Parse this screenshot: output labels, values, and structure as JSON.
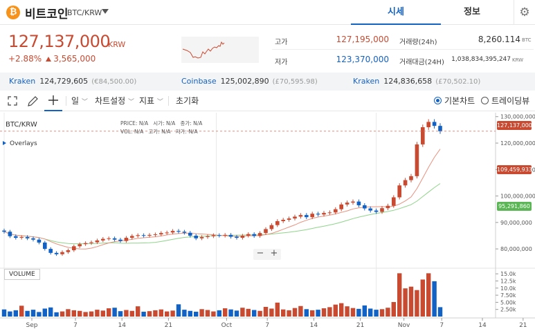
{
  "header": {
    "coin_symbol_glyph": "₿",
    "coin_name": "비트코인",
    "pair": "BTC/KRW",
    "tabs": [
      {
        "label": "시세",
        "active": true
      },
      {
        "label": "정보",
        "active": false
      }
    ],
    "settings_icon": "gear-icon"
  },
  "price": {
    "current": "127,137,000",
    "unit": "KRW",
    "change_pct": "+2.88%",
    "change_amt": "3,565,000"
  },
  "stats": {
    "high_label": "고가",
    "high_value": "127,195,000",
    "low_label": "저가",
    "low_value": "123,370,000",
    "volume_label": "거래량(24h)",
    "volume_value": "8,260.114",
    "volume_unit": "BTC",
    "amount_label": "거래대금(24H)",
    "amount_value": "1,038,834,395,247",
    "amount_unit": "KRW"
  },
  "exchanges": [
    {
      "name": "Kraken",
      "price": "124,729,605",
      "sub": "(€84,500.00)"
    },
    {
      "name": "Coinbase",
      "price": "125,002,890",
      "sub": "(£70,595.98)"
    },
    {
      "name": "Kraken",
      "price": "124,836,658",
      "sub": "(£70,502.10)"
    }
  ],
  "toolbar": {
    "expand_icon": "expand-icon",
    "pen_icon": "pen-icon",
    "crosshair_icon": "crosshair-icon",
    "interval": "일",
    "chart_settings": "차트설정",
    "indicators": "지표",
    "reset": "초기화",
    "view_basic": "기본차트",
    "view_tradingview": "트레이딩뷰"
  },
  "chart": {
    "symbol": "BTC/KRW",
    "ohlc_labels": [
      "PRICE:",
      "N/A",
      "시가:",
      "N/A",
      "종가:",
      "N/A",
      "VOL:",
      "N/A",
      "고가:",
      "N/A",
      "저가:",
      "N/A"
    ],
    "overlays_label": "Overlays",
    "volume_label": "VOLUME",
    "zoom_minus": "−",
    "zoom_plus": "+",
    "last_price_label": "127,137,000",
    "ma1_label": "109,459,933",
    "ma2_label": "95,291,860"
  },
  "chart_data": {
    "type": "candlestick",
    "price_axis_ticks": [
      "130,000,000",
      "120,000,000",
      "110,000,000",
      "100,000,000",
      "90,000,000",
      "80,000,000"
    ],
    "price_axis_values": [
      130000000,
      120000000,
      110000000,
      100000000,
      90000000,
      80000000
    ],
    "volume_axis_ticks": [
      "15.0k",
      "12.5k",
      "10.0k",
      "7.50k",
      "5.00k",
      "2.50k"
    ],
    "volume_axis_values": [
      15000,
      12500,
      10000,
      7500,
      5000,
      2500
    ],
    "x_ticks": [
      "Sep",
      "7",
      "14",
      "21",
      "Oct",
      "7",
      "14",
      "21",
      "Nov",
      "7",
      "14",
      "21"
    ],
    "ylim": [
      73500000,
      131500000
    ],
    "volume_ylim": [
      0,
      16500
    ],
    "closes": [
      86500000,
      84800000,
      84200000,
      84500000,
      84000000,
      83500000,
      82400000,
      80000000,
      78500000,
      78000000,
      78800000,
      79500000,
      81000000,
      81800000,
      82200000,
      82500000,
      83200000,
      83800000,
      84000000,
      83500000,
      83000000,
      84200000,
      84900000,
      85200000,
      85000000,
      85300000,
      85500000,
      86000000,
      86200000,
      86800000,
      86500000,
      86100000,
      85000000,
      84000000,
      84500000,
      84800000,
      85200000,
      85000000,
      85300000,
      84600000,
      84200000,
      85000000,
      85600000,
      84900000,
      86000000,
      87500000,
      89000000,
      90500000,
      91000000,
      91500000,
      92200000,
      92800000,
      92000000,
      93300000,
      93000000,
      93600000,
      93800000,
      95000000,
      96800000,
      97500000,
      97900000,
      96500000,
      95300000,
      94500000,
      94000000,
      95400000,
      96300000,
      99500000,
      104000000,
      106000000,
      107500000,
      119500000,
      126000000,
      128000000,
      126500000,
      124500000
    ],
    "volumes": [
      2500,
      1800,
      2200,
      3800,
      2000,
      2400,
      1600,
      2800,
      3200,
      1500,
      1800,
      2600,
      2200,
      2000,
      1600,
      1800,
      2400,
      2100,
      2900,
      3100,
      1900,
      2300,
      2000,
      3600,
      1700,
      1900,
      2200,
      2500,
      1800,
      2100,
      4300,
      2400,
      2000,
      1700,
      2600,
      2300,
      1800,
      2200,
      2900,
      2500,
      2100,
      3100,
      2700,
      2300,
      2000,
      3400,
      2800,
      4900,
      2500,
      2200,
      3000,
      3700,
      2600,
      2200,
      2400,
      2900,
      3300,
      4200,
      4700,
      3600,
      3000,
      2700,
      3900,
      2800,
      2400,
      2600,
      3100,
      5100,
      15200,
      9900,
      10500,
      9300,
      13000,
      15200,
      12400,
      3300
    ]
  },
  "colors": {
    "up": "#c84a31",
    "down": "#1261c4",
    "ma_fast": "#e8917d",
    "ma_slow": "#8fd48a",
    "accent": "#1261c4",
    "ma2_tag": "#5bb755"
  }
}
